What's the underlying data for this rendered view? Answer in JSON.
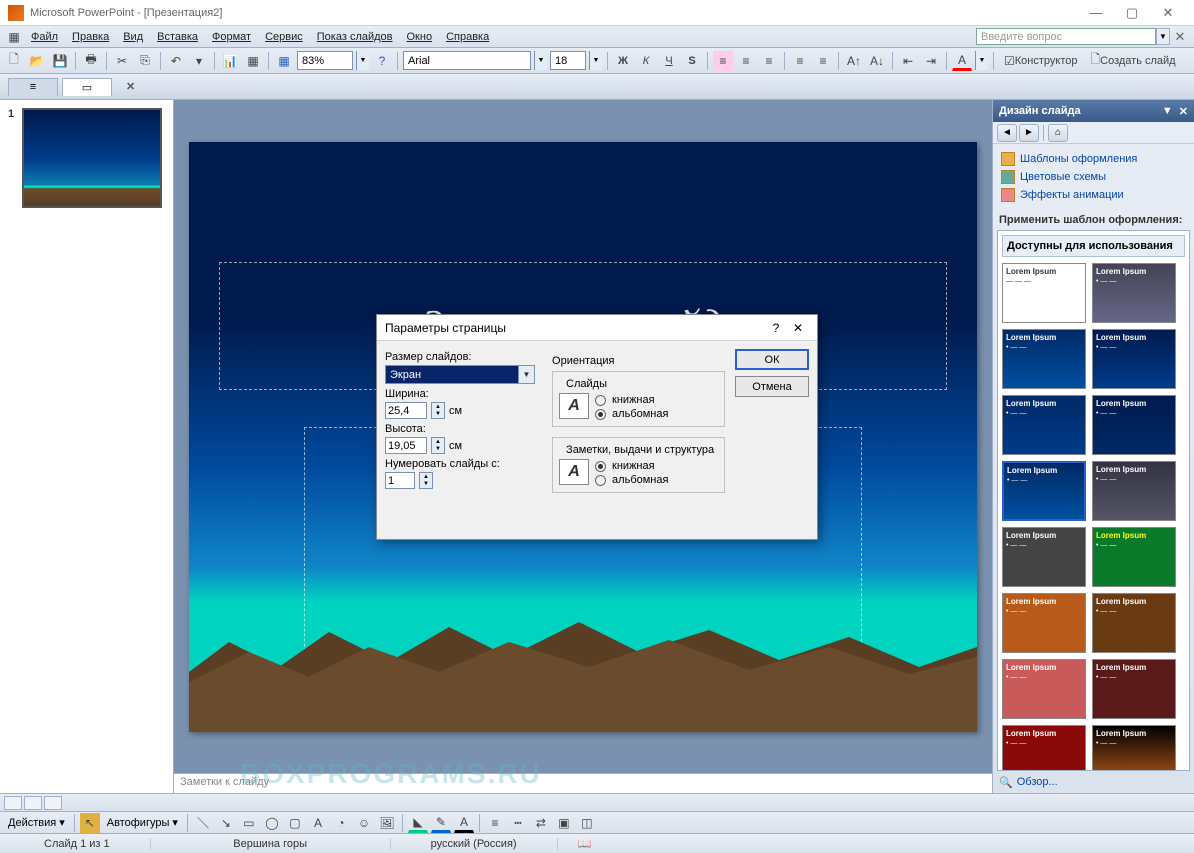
{
  "title": "Microsoft PowerPoint - [Презентация2]",
  "menu": [
    "Файл",
    "Правка",
    "Вид",
    "Вставка",
    "Формат",
    "Сервис",
    "Показ слайдов",
    "Окно",
    "Справка"
  ],
  "help_placeholder": "Введите вопрос",
  "toolbar": {
    "zoom": "83%",
    "font": "Arial",
    "size": "18",
    "constructor": "Конструктор",
    "newslide": "Создать слайд"
  },
  "thumbs": {
    "num": "1"
  },
  "slide": {
    "title": "Заголовок слайда"
  },
  "notes": "Заметки к слайду",
  "panel": {
    "title": "Дизайн слайда",
    "links": [
      "Шаблоны оформления",
      "Цветовые схемы",
      "Эффекты анимации"
    ],
    "apply": "Применить шаблон оформления:",
    "avail": "Доступны для использования",
    "browse": "Обзор..."
  },
  "dialog": {
    "title": "Параметры страницы",
    "size_lbl": "Размер слайдов:",
    "size_val": "Экран",
    "width_lbl": "Ширина:",
    "width_val": "25,4",
    "height_lbl": "Высота:",
    "height_val": "19,05",
    "unit": "см",
    "number_lbl": "Нумеровать слайды с:",
    "number_val": "1",
    "orientation": "Ориентация",
    "slides_grp": "Слайды",
    "notes_grp": "Заметки, выдачи и структура",
    "portrait": "книжная",
    "landscape": "альбомная",
    "ok": "ОК",
    "cancel": "Отмена"
  },
  "draw": {
    "actions": "Действия",
    "autoshapes": "Автофигуры"
  },
  "status": {
    "slide": "Слайд 1 из 1",
    "template": "Вершина горы",
    "lang": "русский (Россия)"
  },
  "watermark": "BOXPROGRAMS.RU"
}
